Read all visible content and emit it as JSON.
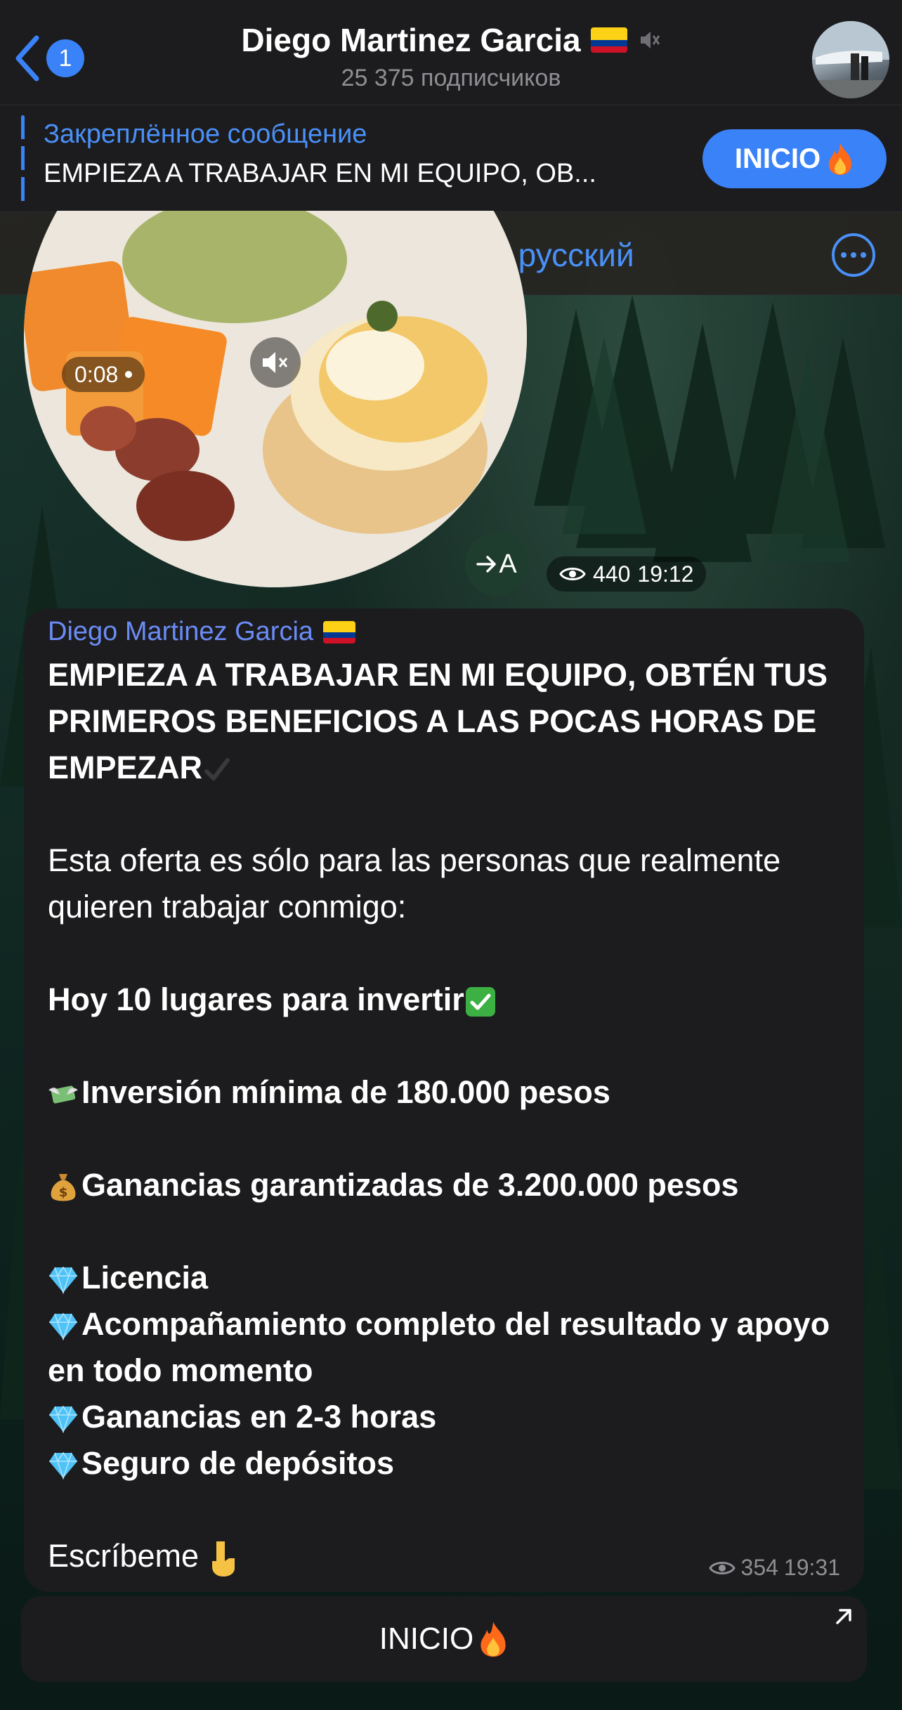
{
  "header": {
    "unread_count": "1",
    "channel_name": "Diego Martinez Garcia",
    "subscribers": "25 375 подписчиков"
  },
  "pinned": {
    "title": "Закреплённое сообщение",
    "text": "EMPIEZA A TRABAJAR EN MI EQUIPO, OB...",
    "button_label": "INICIO"
  },
  "translate_bar": {
    "label": "Перевести на русский"
  },
  "video_message": {
    "duration": "0:08",
    "views": "440",
    "time": "19:12",
    "translate_label": "A"
  },
  "post": {
    "sender": "Diego Martinez Garcia",
    "headline": "EMPIEZA A TRABAJAR EN MI EQUIPO, OBTÉN TUS PRIMEROS BENEFICIOS A LAS POCAS HORAS DE EMPEZAR",
    "intro": "Esta oferta es sólo para las personas que realmente quieren trabajar conmigo:",
    "places": "Hoy 10 lugares para invertir",
    "min_investment": "Inversión mínima de 180.000 pesos",
    "guaranteed": "Ganancias garantizadas de 3.200.000 pesos",
    "bullets": [
      "Licencia",
      "Acompañamiento completo del resultado y apoyo en todo momento",
      "Ganancias en 2-3 horas",
      "Seguro de depósitos"
    ],
    "cta": "Escríbeme",
    "views": "354",
    "time": "19:31"
  },
  "inline_button": {
    "label": "INICIO"
  },
  "colors": {
    "accent": "#3a82f7",
    "link": "#4a90f7",
    "sender": "#6b8cf5",
    "bubble": "#1c1c1e",
    "header": "#1c1c1e"
  }
}
